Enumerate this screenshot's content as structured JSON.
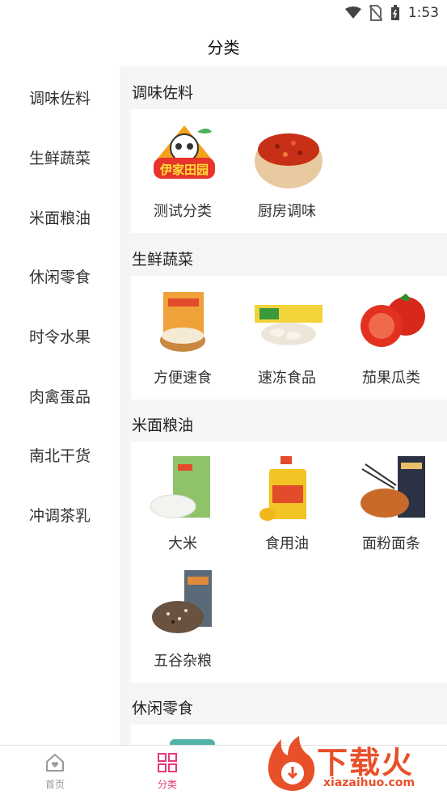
{
  "status_bar": {
    "time": "1:53"
  },
  "header": {
    "title": "分类"
  },
  "sidebar": {
    "items": [
      {
        "label": "调味佐料"
      },
      {
        "label": "生鲜蔬菜"
      },
      {
        "label": "米面粮油"
      },
      {
        "label": "休闲零食"
      },
      {
        "label": "时令水果"
      },
      {
        "label": "肉禽蛋品"
      },
      {
        "label": "南北干货"
      },
      {
        "label": "冲调茶乳"
      }
    ]
  },
  "sections": [
    {
      "title": "调味佐料",
      "items": [
        {
          "label": "测试分类"
        },
        {
          "label": "厨房调味"
        }
      ]
    },
    {
      "title": "生鲜蔬菜",
      "items": [
        {
          "label": "方便速食"
        },
        {
          "label": "速冻食品"
        },
        {
          "label": "茄果瓜类"
        }
      ]
    },
    {
      "title": "米面粮油",
      "items": [
        {
          "label": "大米"
        },
        {
          "label": "食用油"
        },
        {
          "label": "面粉面条"
        },
        {
          "label": "五谷杂粮"
        }
      ]
    },
    {
      "title": "休闲零食",
      "items": []
    }
  ],
  "logo_text": "伊家田园",
  "tabbar": {
    "tabs": [
      {
        "label": "首页",
        "color": "#999999"
      },
      {
        "label": "分类",
        "color": "#e4397b"
      }
    ]
  },
  "watermark": {
    "text": "下载火",
    "url": "xiazaihuo.com"
  },
  "colors": {
    "accent": "#e4397b",
    "content_bg": "#f5f5f5",
    "watermark": "#e8502a"
  }
}
